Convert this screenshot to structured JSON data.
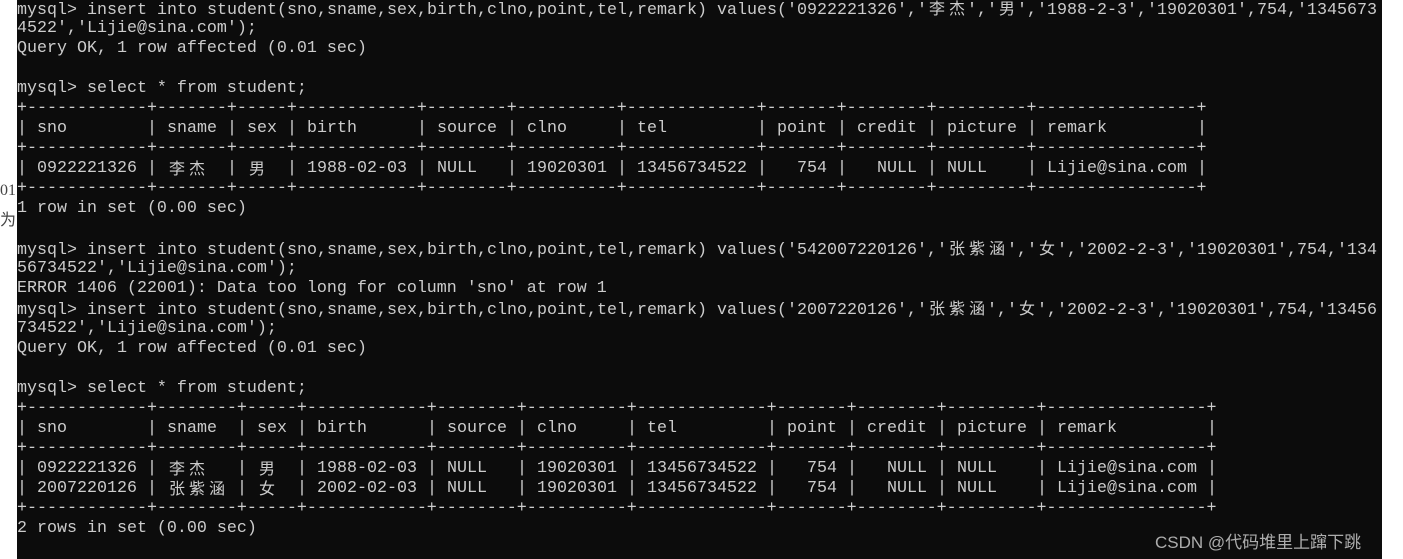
{
  "colors": {
    "terminal_bg": "#0c0c0c",
    "terminal_fg": "#cccccc",
    "page_bg": "#ffffff"
  },
  "left_fragments": [
    "01",
    "为"
  ],
  "watermark": "CSDN @代码堆里上蹿下跳",
  "session": [
    {
      "type": "text",
      "text": "mysql> insert into student(sno,sname,sex,birth,clno,point,tel,remark) values('0922221326','李杰','男','1988-2-3','19020301',754,'1345673"
    },
    {
      "type": "text",
      "text": "4522','Lijie@sina.com');"
    },
    {
      "type": "text",
      "text": "Query OK, 1 row affected (0.01 sec)"
    },
    {
      "type": "text",
      "text": ""
    },
    {
      "type": "text",
      "text": "mysql> select * from student;"
    },
    {
      "type": "table",
      "columns": [
        "sno",
        "sname",
        "sex",
        "birth",
        "source",
        "clno",
        "tel",
        "point",
        "credit",
        "picture",
        "remark"
      ],
      "right_align": [
        "point",
        "credit"
      ],
      "rows": [
        [
          "0922221326",
          "李杰",
          "男",
          "1988-02-03",
          "NULL",
          "19020301",
          "13456734522",
          "754",
          "NULL",
          "NULL",
          "Lijie@sina.com"
        ]
      ]
    },
    {
      "type": "text",
      "text": "1 row in set (0.00 sec)"
    },
    {
      "type": "text",
      "text": ""
    },
    {
      "type": "text",
      "text": "mysql> insert into student(sno,sname,sex,birth,clno,point,tel,remark) values('542007220126','张紫涵','女','2002-2-3','19020301',754,'134"
    },
    {
      "type": "text",
      "text": "56734522','Lijie@sina.com');"
    },
    {
      "type": "text",
      "text": "ERROR 1406 (22001): Data too long for column 'sno' at row 1"
    },
    {
      "type": "text",
      "text": "mysql> insert into student(sno,sname,sex,birth,clno,point,tel,remark) values('2007220126','张紫涵','女','2002-2-3','19020301',754,'13456"
    },
    {
      "type": "text",
      "text": "734522','Lijie@sina.com');"
    },
    {
      "type": "text",
      "text": "Query OK, 1 row affected (0.01 sec)"
    },
    {
      "type": "text",
      "text": ""
    },
    {
      "type": "text",
      "text": "mysql> select * from student;"
    },
    {
      "type": "table",
      "columns": [
        "sno",
        "sname",
        "sex",
        "birth",
        "source",
        "clno",
        "tel",
        "point",
        "credit",
        "picture",
        "remark"
      ],
      "right_align": [
        "point",
        "credit"
      ],
      "rows": [
        [
          "0922221326",
          "李杰",
          "男",
          "1988-02-03",
          "NULL",
          "19020301",
          "13456734522",
          "754",
          "NULL",
          "NULL",
          "Lijie@sina.com"
        ],
        [
          "2007220126",
          "张紫涵",
          "女",
          "2002-02-03",
          "NULL",
          "19020301",
          "13456734522",
          "754",
          "NULL",
          "NULL",
          "Lijie@sina.com"
        ]
      ]
    },
    {
      "type": "text",
      "text": "2 rows in set (0.00 sec)"
    }
  ]
}
